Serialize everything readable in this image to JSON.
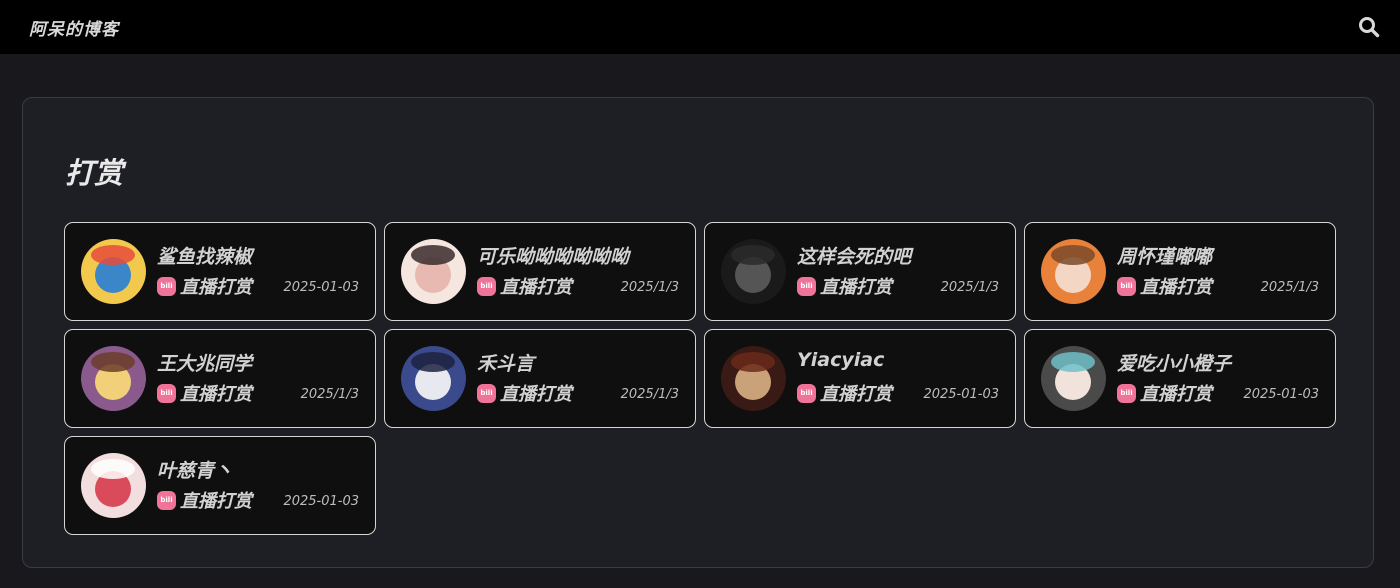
{
  "header": {
    "site_title": "阿呆的博客",
    "search_icon": "search-icon"
  },
  "page": {
    "title": "打赏"
  },
  "colors": {
    "background": "#18181d",
    "topbar": "#000000",
    "panel": "#1e1f24",
    "card": "#0f0f10",
    "platform_accent": "#f0739a"
  },
  "donations": [
    {
      "name": "鲨鱼找辣椒",
      "platform": "直播打赏",
      "platform_icon": "bilibili-icon",
      "date": "2025-01-03",
      "avatar_colors": [
        "#f2c94c",
        "#3a86c8",
        "#e74c3c"
      ]
    },
    {
      "name": "可乐呦呦呦呦呦呦",
      "platform": "直播打赏",
      "platform_icon": "bilibili-icon",
      "date": "2025/1/3",
      "avatar_colors": [
        "#f6e6e0",
        "#e8b9b0",
        "#3a2a2a"
      ]
    },
    {
      "name": "这样会死的吧",
      "platform": "直播打赏",
      "platform_icon": "bilibili-icon",
      "date": "2025/1/3",
      "avatar_colors": [
        "#1a1a1a",
        "#555555",
        "#2c2c2c"
      ]
    },
    {
      "name": "周怀瑾嘟嘟",
      "platform": "直播打赏",
      "platform_icon": "bilibili-icon",
      "date": "2025/1/3",
      "avatar_colors": [
        "#e8823a",
        "#f4d6c4",
        "#7a4a2a"
      ]
    },
    {
      "name": "王大兆同学",
      "platform": "直播打赏",
      "platform_icon": "bilibili-icon",
      "date": "2025/1/3",
      "avatar_colors": [
        "#8a5a8c",
        "#f2d07a",
        "#6b3d2a"
      ]
    },
    {
      "name": "禾斗言",
      "platform": "直播打赏",
      "platform_icon": "bilibili-icon",
      "date": "2025/1/3",
      "avatar_colors": [
        "#3b4a8c",
        "#e8e8f0",
        "#1e2240"
      ]
    },
    {
      "name": "Yiacyiac",
      "platform": "直播打赏",
      "platform_icon": "bilibili-icon",
      "date": "2025-01-03",
      "avatar_colors": [
        "#3a1a14",
        "#c9a27a",
        "#6a2a1a"
      ]
    },
    {
      "name": "爱吃小小橙子",
      "platform": "直播打赏",
      "platform_icon": "bilibili-icon",
      "date": "2025-01-03",
      "avatar_colors": [
        "#4a4a4a",
        "#f2e2dc",
        "#6ec0c8"
      ]
    },
    {
      "name": "叶慈青丶",
      "platform": "直播打赏",
      "platform_icon": "bilibili-icon",
      "date": "2025-01-03",
      "avatar_colors": [
        "#f2dede",
        "#d94a5a",
        "#ffffff"
      ]
    }
  ]
}
